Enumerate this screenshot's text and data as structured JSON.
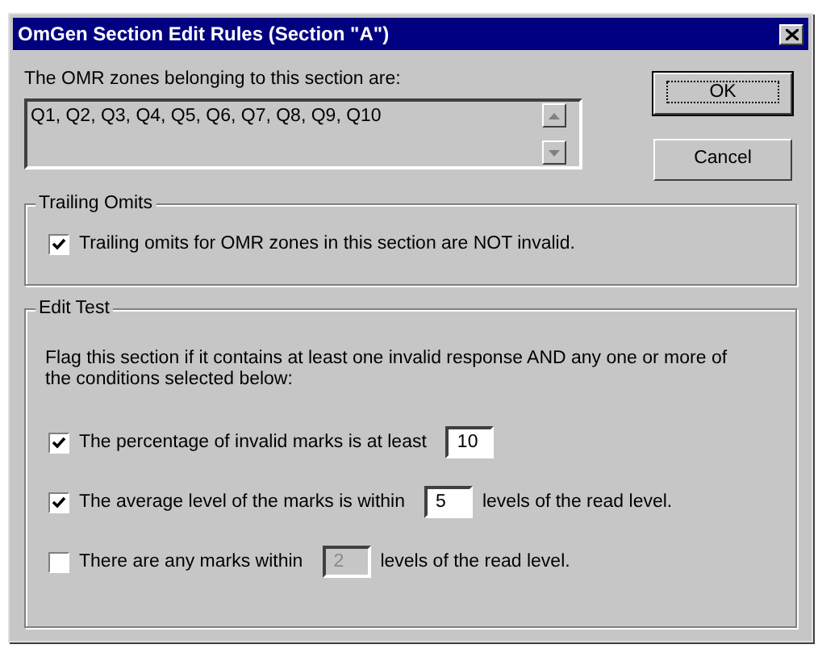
{
  "window": {
    "title": "OmGen Section Edit Rules (Section \"A\")"
  },
  "zones": {
    "label": "The OMR zones belonging to this section are:",
    "value": "Q1, Q2, Q3, Q4, Q5, Q6, Q7, Q8, Q9, Q10"
  },
  "buttons": [
    {
      "label": "OK",
      "default": true
    },
    {
      "label": "Cancel",
      "default": false
    }
  ],
  "trailing_omits": {
    "title": "Trailing Omits",
    "checkbox": {
      "label": "Trailing omits for OMR zones in this section are NOT invalid.",
      "checked": true
    }
  },
  "edit_test": {
    "title": "Edit Test",
    "description": "Flag this section if it contains at least one invalid response AND any one or more of the conditions selected below:",
    "conditions": [
      {
        "label": "The percentage of invalid marks is at least",
        "checked": true,
        "value": "10",
        "disabled": false
      },
      {
        "label": "The average level of the marks is within",
        "checked": true,
        "value": "5",
        "after": "levels of the read level.",
        "disabled": false
      },
      {
        "label": "There are any marks within",
        "checked": false,
        "value": "2",
        "after": "levels of the read level.",
        "disabled": true
      }
    ]
  }
}
